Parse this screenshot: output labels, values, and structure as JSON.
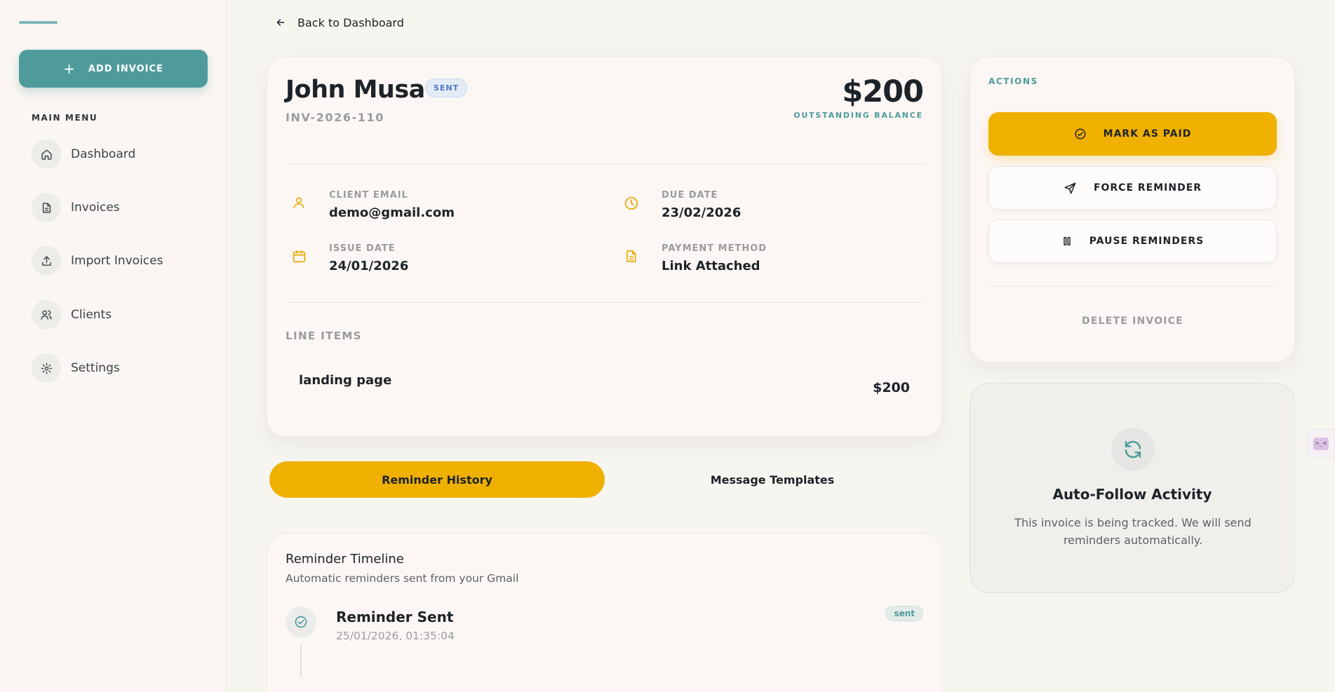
{
  "sidebar": {
    "add_invoice_label": "ADD INVOICE",
    "menu_title": "MAIN MENU",
    "items": [
      {
        "label": "Dashboard",
        "icon": "home-icon"
      },
      {
        "label": "Invoices",
        "icon": "document-icon"
      },
      {
        "label": "Import Invoices",
        "icon": "upload-icon"
      },
      {
        "label": "Clients",
        "icon": "users-icon"
      },
      {
        "label": "Settings",
        "icon": "gear-icon"
      }
    ]
  },
  "header": {
    "back_label": "Back to Dashboard"
  },
  "invoice": {
    "client_name": "John Musa",
    "status": "SENT",
    "number": "INV-2026-110",
    "amount": "$200",
    "balance_label": "OUTSTANDING BALANCE",
    "fields": {
      "client_email": {
        "label": "CLIENT EMAIL",
        "value": "demo@gmail.com"
      },
      "due_date": {
        "label": "DUE DATE",
        "value": "23/02/2026"
      },
      "issue_date": {
        "label": "ISSUE DATE",
        "value": "24/01/2026"
      },
      "payment_method": {
        "label": "PAYMENT METHOD",
        "value": "Link Attached"
      }
    },
    "line_items_title": "LINE ITEMS",
    "line_items": [
      {
        "name": "landing page",
        "amount": "$200"
      }
    ]
  },
  "tabs": [
    {
      "label": "Reminder History",
      "active": true
    },
    {
      "label": "Message Templates",
      "active": false
    }
  ],
  "timeline": {
    "title": "Reminder Timeline",
    "subtitle": "Automatic reminders sent from your Gmail",
    "events": [
      {
        "title": "Reminder Sent",
        "time": "25/01/2026, 01:35:04",
        "badge": "sent"
      }
    ]
  },
  "actions": {
    "title": "ACTIONS",
    "mark_paid": "MARK AS PAID",
    "force_reminder": "FORCE REMINDER",
    "pause_reminders": "PAUSE REMINDERS",
    "delete": "DELETE INVOICE"
  },
  "activity": {
    "title": "Auto-Follow Activity",
    "text": "This invoice is being tracked. We will send reminders automatically."
  },
  "widget": {
    "glyph": ">_<"
  },
  "colors": {
    "accent_teal": "#4f9b9b",
    "accent_yellow": "#f0b000",
    "status_blue": "#4a78c9",
    "icon_yellow": "#eaab0c"
  }
}
